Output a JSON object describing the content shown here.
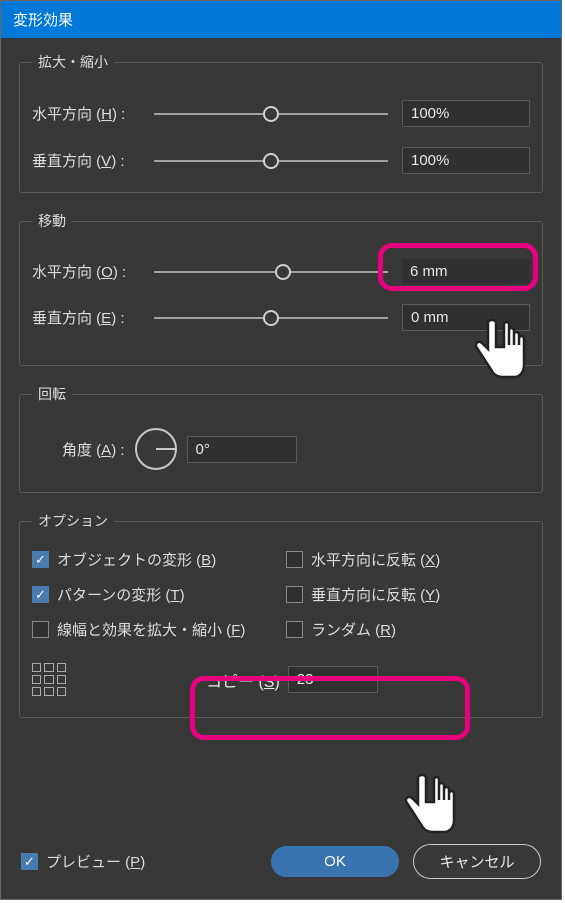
{
  "dialog": {
    "title": "変形効果"
  },
  "scale": {
    "legend": "拡大・縮小",
    "h_label_pre": "水平方向 (",
    "h_key": "H",
    "h_label_post": ") :",
    "h_value": "100%",
    "v_label_pre": "垂直方向 (",
    "v_key": "V",
    "v_label_post": ") :",
    "v_value": "100%"
  },
  "move": {
    "legend": "移動",
    "h_label_pre": "水平方向 (",
    "h_key": "O",
    "h_label_post": ") :",
    "h_value": "6 mm",
    "v_label_pre": "垂直方向 (",
    "v_key": "E",
    "v_label_post": ") :",
    "v_value": "0 mm"
  },
  "rotate": {
    "legend": "回転",
    "angle_label_pre": "角度 (",
    "angle_key": "A",
    "angle_label_post": ") :",
    "angle_value": "0°"
  },
  "options": {
    "legend": "オプション",
    "items": [
      {
        "label_pre": "オブジェクトの変形 (",
        "key": "B",
        "label_post": ")",
        "checked": true
      },
      {
        "label_pre": "水平方向に反転 (",
        "key": "X",
        "label_post": ")",
        "checked": false
      },
      {
        "label_pre": "パターンの変形 (",
        "key": "T",
        "label_post": ")",
        "checked": true
      },
      {
        "label_pre": "垂直方向に反転 (",
        "key": "Y",
        "label_post": ")",
        "checked": false
      },
      {
        "label_pre": "線幅と効果を拡大・縮小 (",
        "key": "F",
        "label_post": ")",
        "checked": false
      },
      {
        "label_pre": "ランダム (",
        "key": "R",
        "label_post": ")",
        "checked": false
      }
    ],
    "copy_label_pre": "コピー (",
    "copy_key": "S",
    "copy_label_post": ")",
    "copy_value": "23"
  },
  "footer": {
    "preview_label_pre": "プレビュー (",
    "preview_key": "P",
    "preview_label_post": ")",
    "preview_checked": true,
    "ok": "OK",
    "cancel": "キャンセル"
  }
}
